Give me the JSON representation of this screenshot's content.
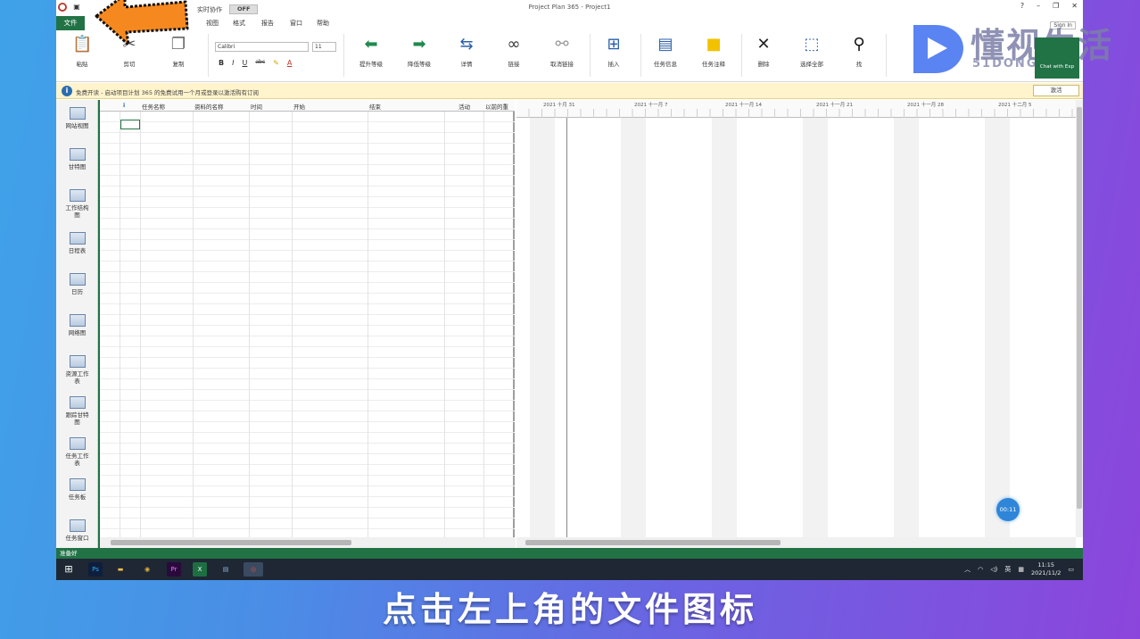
{
  "window": {
    "title": "Project Plan 365 - Project1",
    "collab_label": "实时协作",
    "collab_toggle": "OFF",
    "controls": [
      "?",
      "–",
      "❐",
      "✕"
    ],
    "sign_in": "Sign In"
  },
  "ribbon_tabs": [
    {
      "label": "文件"
    },
    {
      "label": "目"
    },
    {
      "label": "视图"
    },
    {
      "label": "格式"
    },
    {
      "label": "报告"
    },
    {
      "label": "窗口"
    },
    {
      "label": "帮助"
    }
  ],
  "ribbon": {
    "paste": "粘贴",
    "cut": "剪切",
    "copy": "复制",
    "font_name": "Calibri",
    "font_size": "11",
    "bold": "B",
    "italic": "I",
    "underline": "U",
    "strike": "abc",
    "outdent": "提升等级",
    "indent": "降低等级",
    "link_tasks": "详情",
    "link": "链接",
    "unlink": "取消链接",
    "insert": "插入",
    "task_info": "任务信息",
    "task_notes": "任务注释",
    "delete": "删除",
    "select_all": "选择全部",
    "find": "找"
  },
  "info_bar": {
    "text": "免费开读 - 启动项目计划 365 的免费试用一个月或登录以激活购有订阅",
    "button": "激活"
  },
  "views": [
    {
      "label": "网站视图"
    },
    {
      "label": "甘特图"
    },
    {
      "label": "工作结构\n图"
    },
    {
      "label": "日程表"
    },
    {
      "label": "日历"
    },
    {
      "label": "网络图"
    },
    {
      "label": "资源工作\n表"
    },
    {
      "label": "跟踪甘特\n图"
    },
    {
      "label": "任务工作\n表"
    },
    {
      "label": "任务板"
    },
    {
      "label": "任务窗口"
    }
  ],
  "grid": {
    "columns": [
      "任务名称",
      "资料的名称",
      "时间",
      "开始",
      "结束",
      "活动",
      "以前的重"
    ],
    "info_icon": "i"
  },
  "gantt": {
    "weeks": [
      "2021 十月 31",
      "2021 十一月 7",
      "2021 十一月 14",
      "2021 十一月 21",
      "2021 十一月 28",
      "2021 十二月 5"
    ]
  },
  "timer": "00:11",
  "status_bar": "准备好",
  "taskbar": {
    "apps": [
      "Ps",
      "▬",
      "◉",
      "Pr",
      "X",
      "▤",
      "◎"
    ],
    "tray_lang": "英",
    "time": "11:15",
    "date": "2021/11/2"
  },
  "logo": {
    "cn": "懂视生活",
    "en": "51DONG.COM"
  },
  "chat_tile": "Chat with Exp",
  "subtitle": "点击左上角的文件图标",
  "colors": {
    "accent_green": "#217346",
    "info_bar": "#fff4cc",
    "arrow_orange": "#f5891f"
  }
}
